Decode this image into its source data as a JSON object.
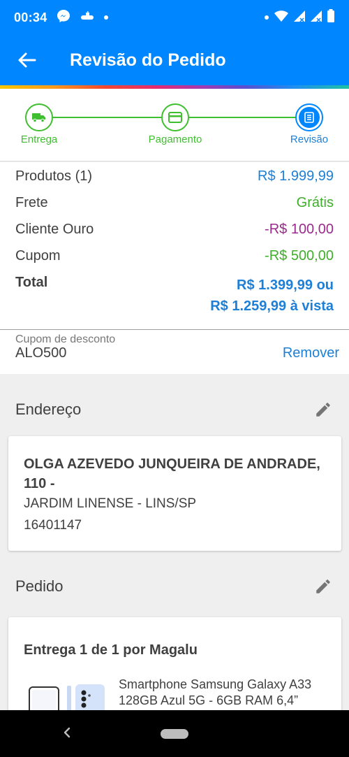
{
  "status_bar": {
    "time": "00:34",
    "icons_left": [
      "messenger-icon",
      "submarine-icon",
      "dot-icon"
    ],
    "icons_right": [
      "dot-icon",
      "wifi-icon",
      "signal-icon",
      "signal-icon",
      "battery-icon"
    ]
  },
  "appbar": {
    "title": "Revisão do Pedido",
    "back_icon": "arrow-left-icon"
  },
  "stepper": {
    "steps": [
      {
        "label": "Entrega",
        "icon": "truck-icon",
        "state": "done"
      },
      {
        "label": "Pagamento",
        "icon": "card-icon",
        "state": "done"
      },
      {
        "label": "Revisão",
        "icon": "document-icon",
        "state": "active"
      }
    ]
  },
  "summary": {
    "products_label": "Produtos (1)",
    "products_value": "R$ 1.999,99",
    "shipping_label": "Frete",
    "shipping_value": "Grátis",
    "gold_label": "Cliente Ouro",
    "gold_value": "-R$ 100,00",
    "coupon_label": "Cupom",
    "coupon_value": "-R$ 500,00",
    "total_label": "Total",
    "total_line1": "R$ 1.399,99 ou",
    "total_line2": "R$ 1.259,99 à vista"
  },
  "coupon": {
    "label": "Cupom de desconto",
    "code": "ALO500",
    "remove": "Remover"
  },
  "address_section": {
    "title": "Endereço",
    "street": "OLGA AZEVEDO JUNQUEIRA DE ANDRADE, 110 -",
    "district": "JARDIM LINENSE - LINS/SP",
    "zip": "16401147"
  },
  "order_section": {
    "title": "Pedido",
    "delivery": "Entrega 1 de 1 por Magalu",
    "product_name": "Smartphone Samsung Galaxy A33 128GB Azul 5G - 6GB RAM 6,4”"
  },
  "colors": {
    "primary": "#0086ff",
    "green": "#3fbf2f",
    "blue_text": "#1e7fd6",
    "purple": "#9b2a8d"
  }
}
